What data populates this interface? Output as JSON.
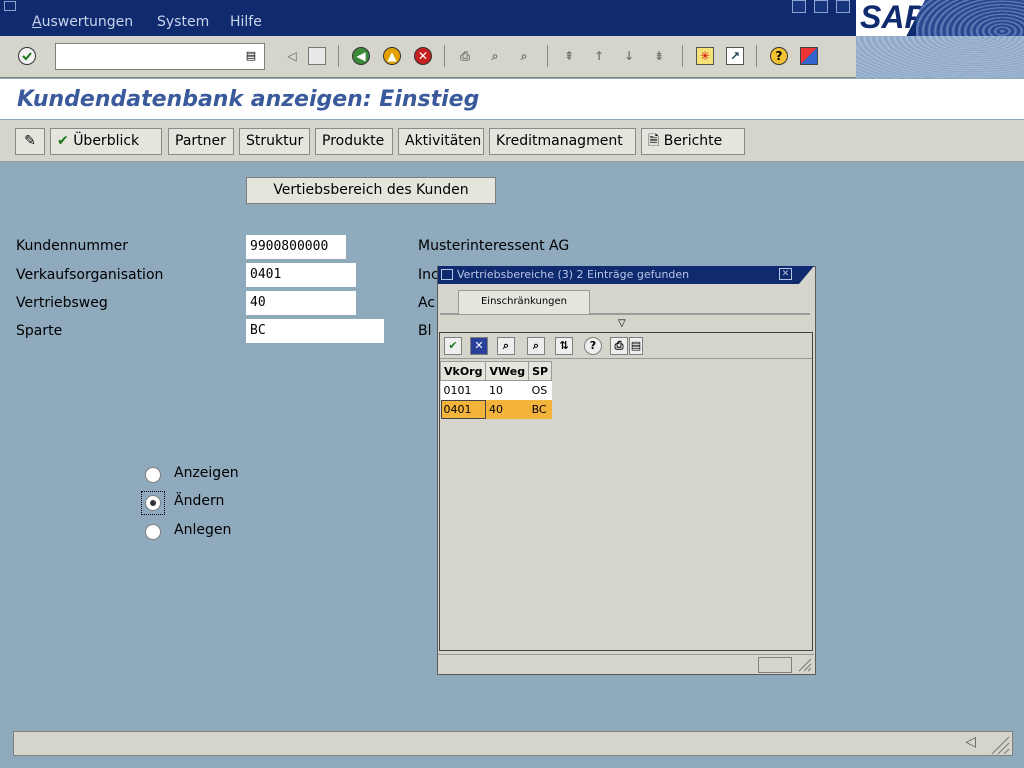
{
  "menu": {
    "items": [
      "Auswertungen",
      "System",
      "Hilfe"
    ]
  },
  "brand": {
    "logo_text": "SAP"
  },
  "toolbar": {
    "command_field_value": ""
  },
  "title": {
    "text": "Kundendatenbank anzeigen: Einstieg"
  },
  "app_toolbar": {
    "buttons": [
      "Überblick",
      "Partner",
      "Struktur",
      "Produkte",
      "Aktivitäten",
      "Kreditmanagment",
      "Berichte"
    ]
  },
  "form": {
    "area_button_label": "Vertiebsbereich des Kunden",
    "fields": [
      {
        "label": "Kundennummer",
        "value": "9900800000",
        "text": "Musterinteressent AG"
      },
      {
        "label": "Verkaufsorganisation",
        "value": "0401",
        "text": "Inc"
      },
      {
        "label": "Vertriebsweg",
        "value": "40",
        "text": "Ac"
      },
      {
        "label": "Sparte",
        "value": "BC",
        "text": "Bl"
      }
    ],
    "radios": [
      {
        "label": "Anzeigen",
        "selected": false
      },
      {
        "label": "Ändern",
        "selected": true
      },
      {
        "label": "Anlegen",
        "selected": false
      }
    ]
  },
  "popup": {
    "title": "Vertriebsbereiche (3)   2 Einträge gefunden",
    "tab_label": "Einschränkungen",
    "columns": [
      "VkOrg",
      "VWeg",
      "SP"
    ],
    "rows": [
      [
        "0101",
        "10",
        "OS"
      ],
      [
        "0401",
        "40",
        "BC"
      ]
    ],
    "selected_row": 1
  },
  "colors": {
    "menubar": "#0f2a6e",
    "background": "#8fa9bd",
    "toolbar": "#d6d5cc",
    "title_text": "#3a5a9c",
    "row_highlight": "#f4b43c"
  }
}
